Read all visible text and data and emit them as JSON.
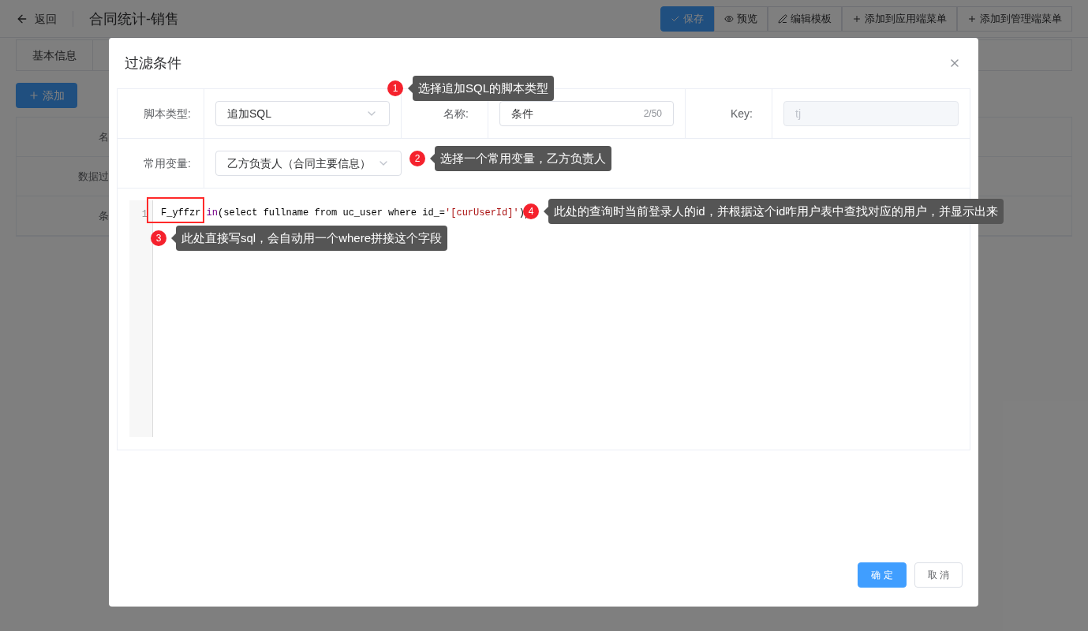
{
  "header": {
    "back": "返回",
    "title": "合同统计-销售"
  },
  "toolbar": [
    {
      "label": "保存",
      "kind": "primary"
    },
    {
      "label": "预览",
      "kind": "eye"
    },
    {
      "label": "编辑模板",
      "kind": "edit"
    },
    {
      "label": "添加到应用端菜单",
      "kind": "plus"
    },
    {
      "label": "添加到管理端菜单",
      "kind": "plus"
    }
  ],
  "tabs": [
    {
      "label": "基本信息"
    }
  ],
  "add_button": "添加",
  "table": {
    "rows": [
      "名",
      "数据过",
      "条"
    ]
  },
  "dialog": {
    "title": "过滤条件",
    "fields": {
      "script_type": {
        "label": "脚本类型:",
        "value": "追加SQL"
      },
      "name": {
        "label": "名称:",
        "value": "条件",
        "count": "2/50"
      },
      "key": {
        "label": "Key:",
        "value": "tj",
        "disabled": true
      },
      "variable": {
        "label": "常用变量:",
        "value": "乙方负责人（合同主要信息）"
      }
    },
    "editor": {
      "line_number": "1",
      "tokens": [
        {
          "text": "F_yffzr ",
          "kind": "plain"
        },
        {
          "text": "in",
          "kind": "keyword"
        },
        {
          "text": "(select fullname from uc_user where id_=",
          "kind": "plain"
        },
        {
          "text": "'[curUserId]'",
          "kind": "string"
        },
        {
          "text": ")",
          "kind": "plain"
        }
      ]
    },
    "buttons": [
      {
        "label": "确 定",
        "kind": "primary"
      },
      {
        "label": "取 消",
        "kind": "default"
      }
    ]
  },
  "annotations": [
    {
      "number": "1",
      "text": "选择追加SQL的脚本类型"
    },
    {
      "number": "2",
      "text": "选择一个常用变量，乙方负责人"
    },
    {
      "number": "3",
      "text": "此处直接写sql，会自动用一个where拼接这个字段"
    },
    {
      "number": "4",
      "text": "此处的查询时当前登录人的id，并根据这个id咋用户表中查找对应的用户，并显示出来"
    }
  ]
}
